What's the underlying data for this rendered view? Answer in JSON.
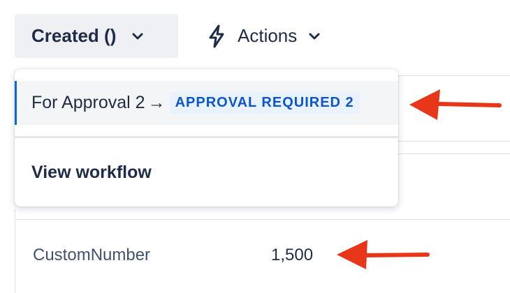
{
  "toolbar": {
    "status_label": "Created ()",
    "actions_label": "Actions",
    "icons": {
      "status_chevron": "chevron-down-icon",
      "actions_icon": "lightning-bolt-icon",
      "actions_chevron": "chevron-down-icon"
    }
  },
  "dropdown": {
    "transition": {
      "name": "For Approval 2",
      "arrow": "→",
      "target_status": "APPROVAL REQUIRED 2"
    },
    "view_workflow_label": "View workflow"
  },
  "fields": [
    {
      "label": "CustomNumber",
      "value": "1,500"
    }
  ],
  "colors": {
    "annotation_arrow": "#e8361b",
    "selected_accent": "#0c66e4",
    "lozenge_text": "#0c55cf",
    "lozenge_bg": "#e9f2ff"
  }
}
